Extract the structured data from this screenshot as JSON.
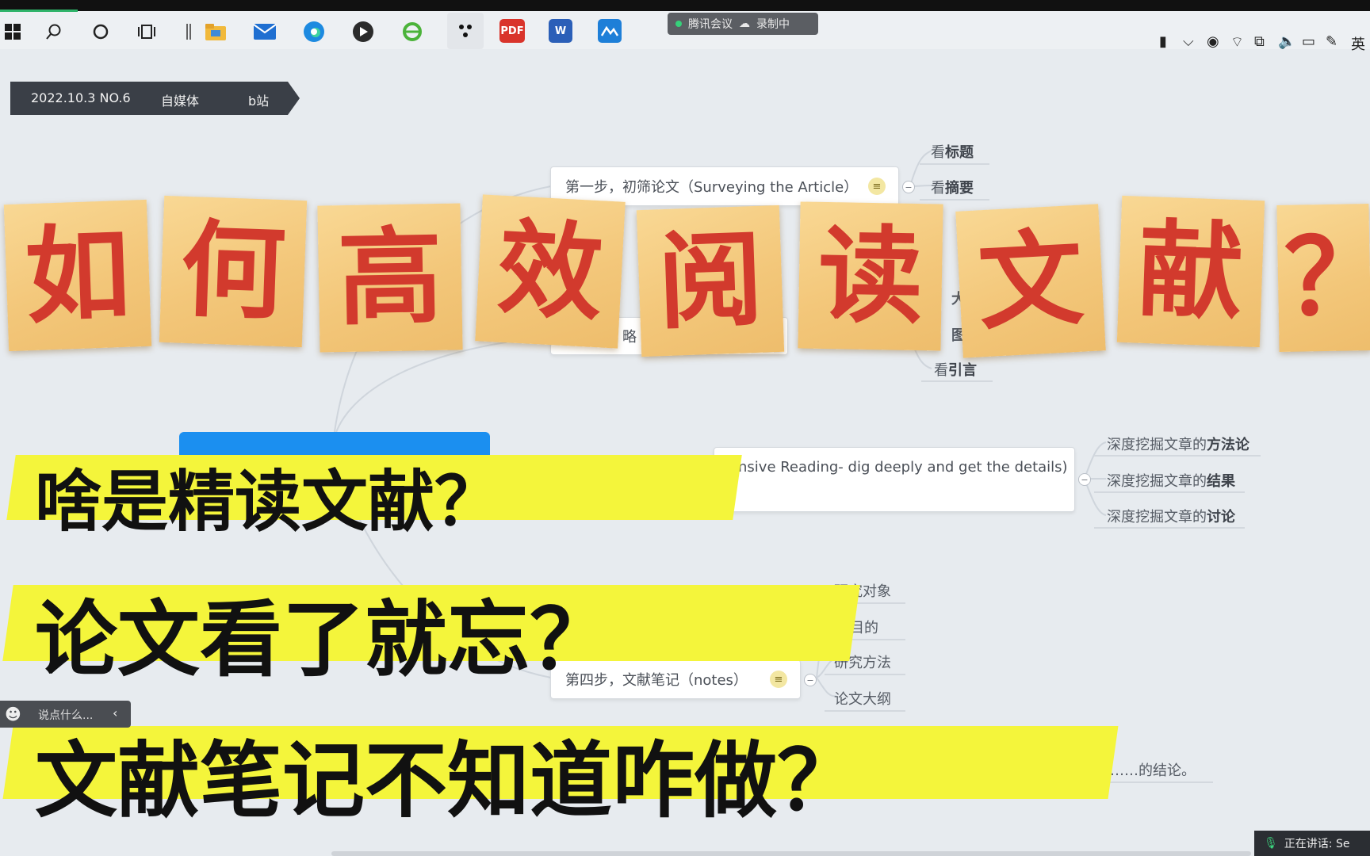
{
  "taskbar": {
    "meeting_app": "腾讯会议",
    "recording": "录制中",
    "ime": "英"
  },
  "breadcrumb": [
    "2022.10.3 NO.6",
    "自媒体",
    "b站"
  ],
  "mindmap": {
    "step1": "第一步，初筛论文（Surveying the Article）",
    "step1_leaves": [
      {
        "pre": "看",
        "bold": "标题"
      },
      {
        "pre": "看",
        "bold": "摘要"
      }
    ],
    "partial_leaves": [
      "大",
      "图",
      "略"
    ],
    "step2_leaf": {
      "pre": "看",
      "bold": "引言"
    },
    "step3": "nsive Reading- dig deeply and get the details)",
    "step3_leaves": [
      {
        "pre": "深度挖掘文章的",
        "bold": "方法论"
      },
      {
        "pre": "深度挖掘文章的",
        "bold": "结果"
      },
      {
        "pre": "深度挖掘文章的",
        "bold": "讨论"
      }
    ],
    "step4": "第四步，文献笔记（notes）",
    "step4_leaves": [
      "研究对象",
      "目的",
      "研究方法",
      "论文大纲"
    ],
    "conclusion": "……的结论。"
  },
  "overlay": {
    "title_chars": [
      "如",
      "何",
      "高",
      "效",
      "阅",
      "读",
      "文",
      "献",
      "？"
    ],
    "questions": [
      "啥是精读文献？",
      "论文看了就忘？",
      "文献笔记不知道咋做？"
    ]
  },
  "danmaku": {
    "placeholder": "说点什么..."
  },
  "speaking": "正在讲话: Se"
}
